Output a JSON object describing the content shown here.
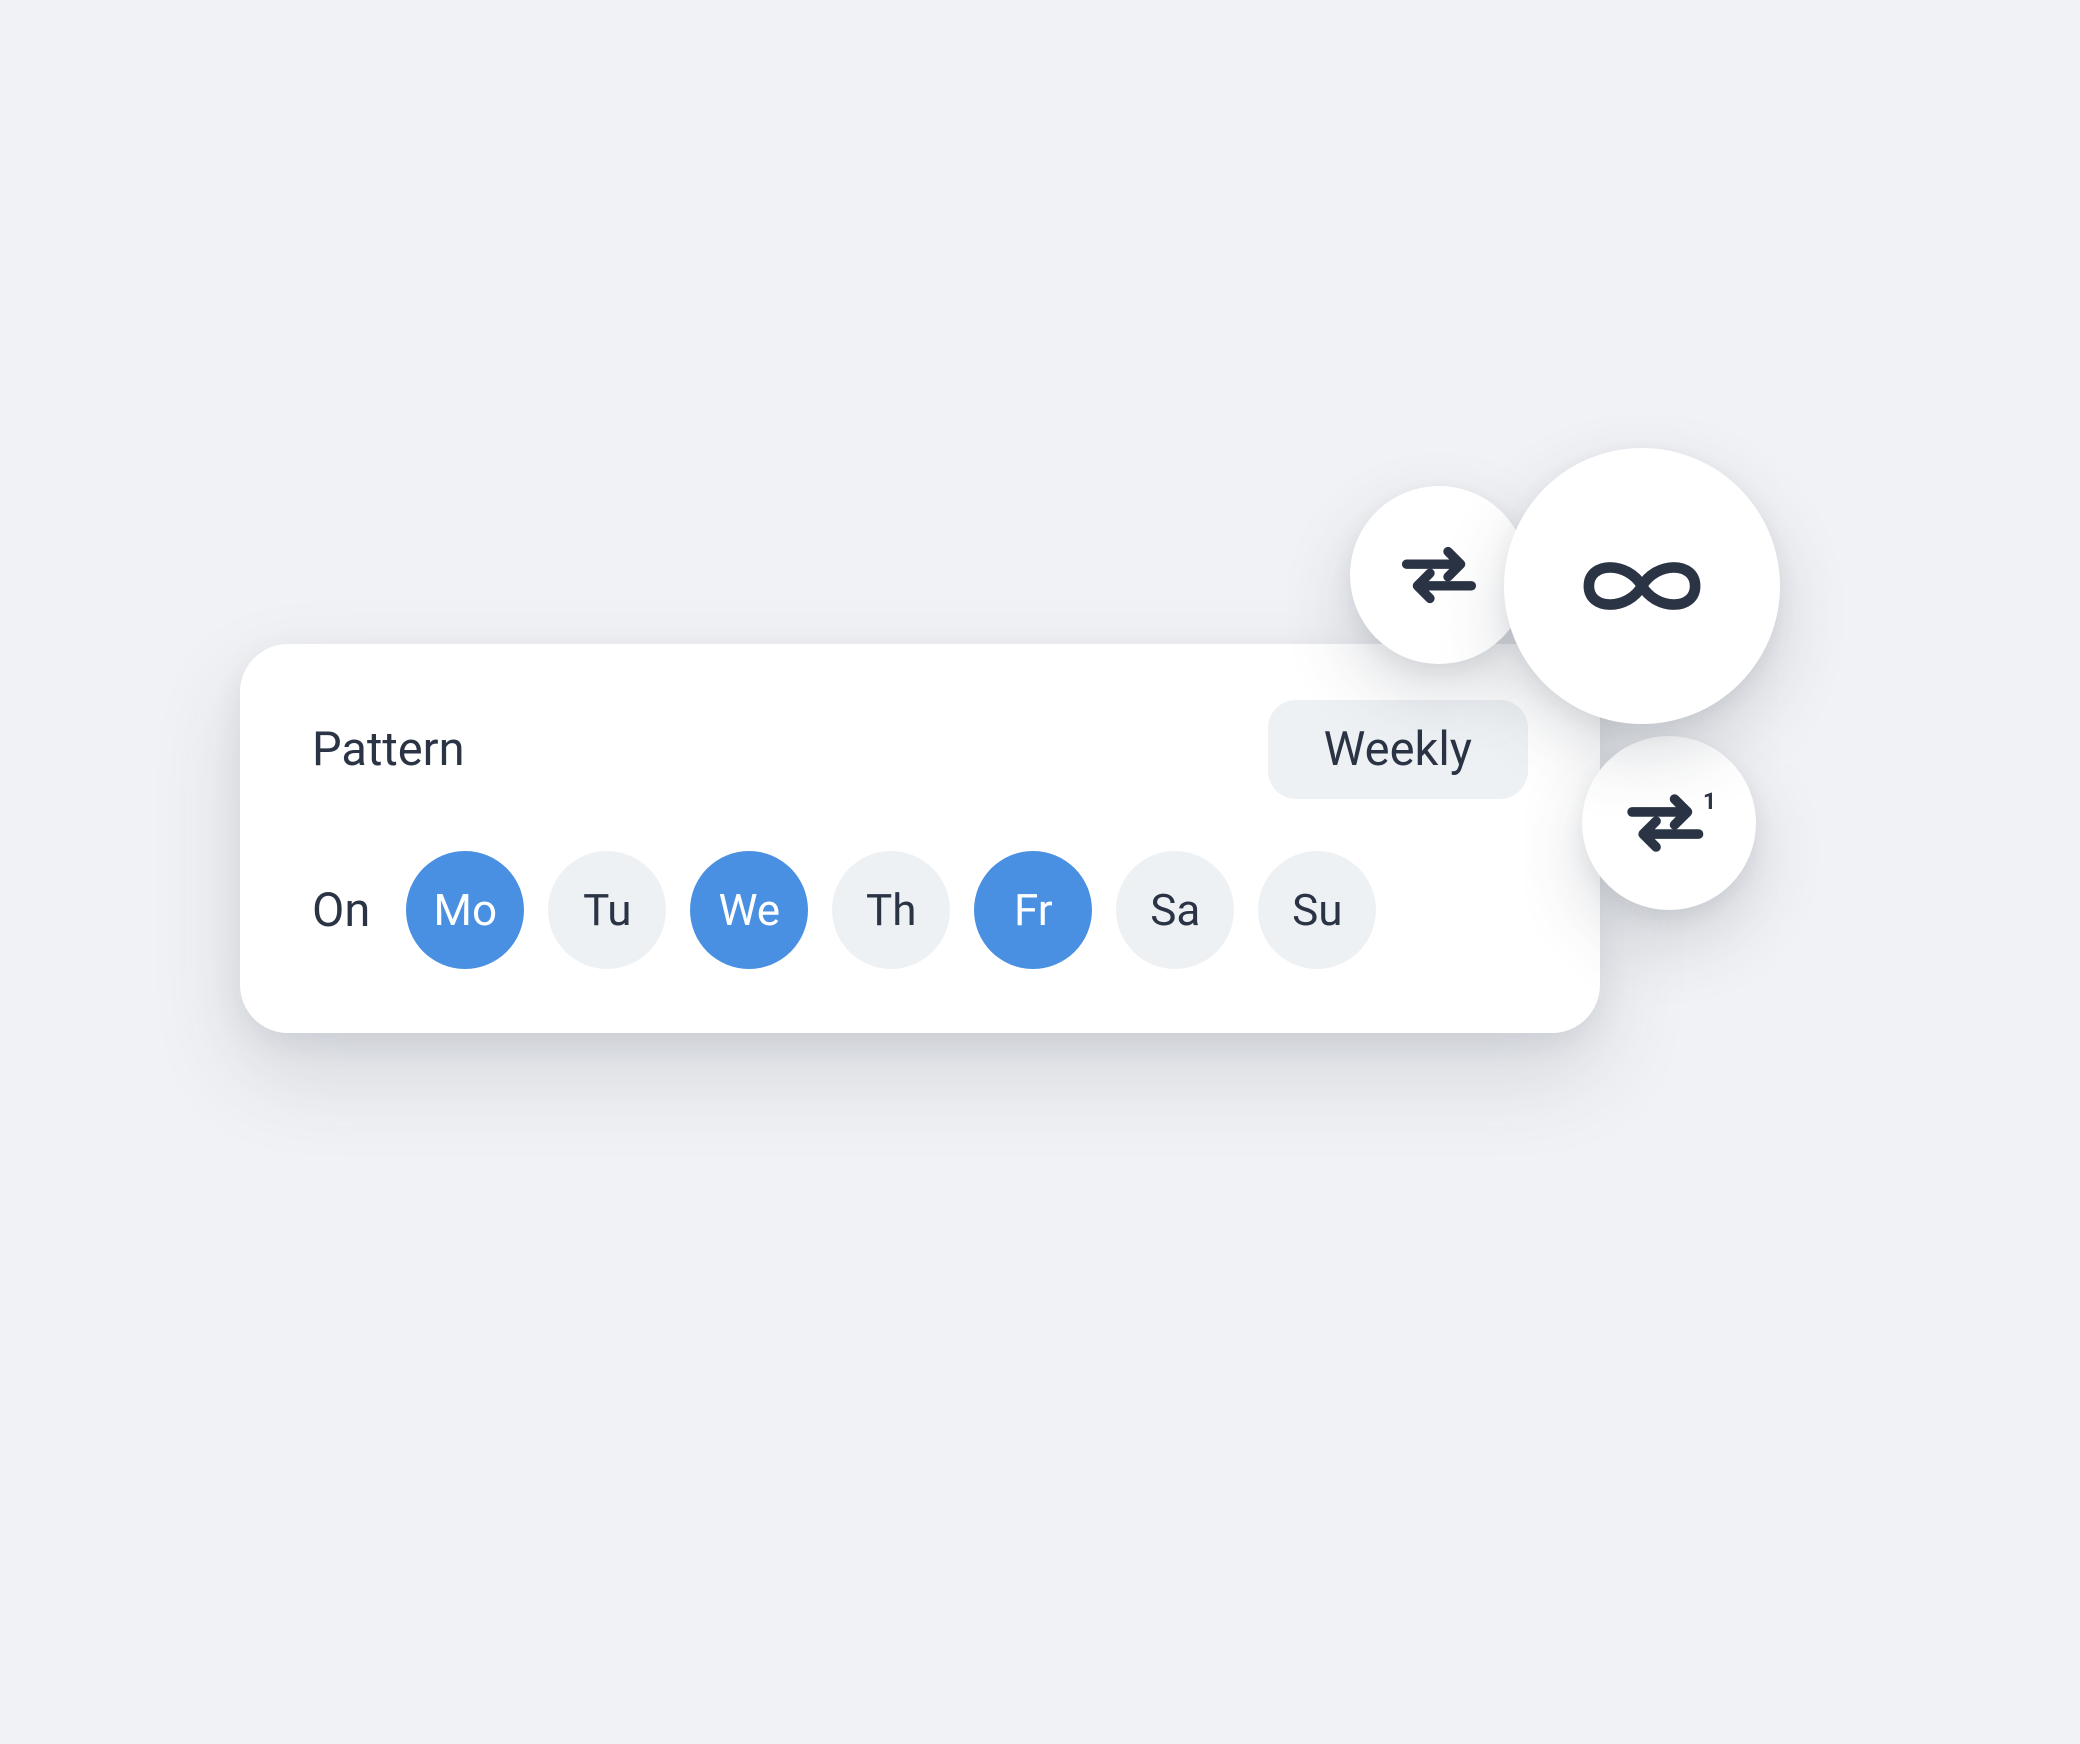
{
  "pattern": {
    "label": "Pattern",
    "value": "Weekly"
  },
  "on": {
    "label": "On",
    "days": [
      {
        "label": "Mo",
        "selected": true
      },
      {
        "label": "Tu",
        "selected": false
      },
      {
        "label": "We",
        "selected": true
      },
      {
        "label": "Th",
        "selected": false
      },
      {
        "label": "Fr",
        "selected": true
      },
      {
        "label": "Sa",
        "selected": false
      },
      {
        "label": "Su",
        "selected": false
      }
    ]
  },
  "icons": {
    "repeat": "repeat-icon",
    "infinity": "infinity-icon",
    "repeat_one": "repeat-one-icon"
  },
  "colors": {
    "accent": "#4a90e2",
    "text": "#2b3445",
    "chip_bg": "#eef1f4",
    "card_bg": "#ffffff",
    "page_bg": "#f1f2f5"
  }
}
